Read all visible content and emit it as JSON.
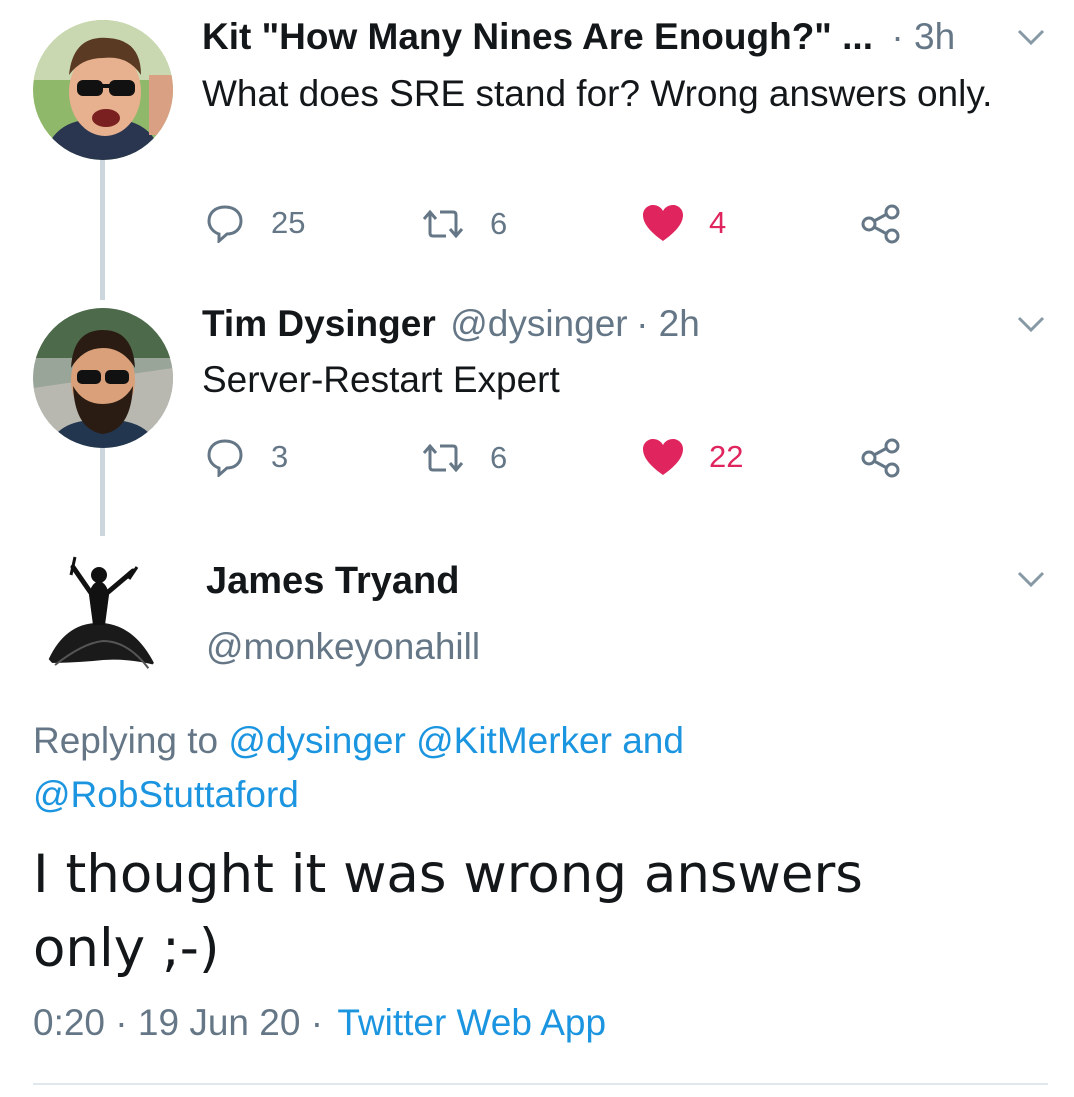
{
  "tweets": [
    {
      "name": "Kit \"How Many Nines Are Enough?\" ...",
      "handle": "",
      "time": "· 3h",
      "text": "What does SRE stand for? Wrong answers only.",
      "reply_count": "25",
      "retweet_count": "6",
      "like_count": "4"
    },
    {
      "name": "Tim Dysinger",
      "handle": "@dysinger",
      "time": "· 2h",
      "text": "Server-Restart Expert",
      "reply_count": "3",
      "retweet_count": "6",
      "like_count": "22"
    }
  ],
  "focused": {
    "name": "James Tryand",
    "handle": "@monkeyonahill",
    "replying_prefix": "Replying to",
    "mention_1": "@dysinger",
    "mention_2": "@KitMerker",
    "and_text": "and",
    "mention_3": "@RobStuttaford",
    "text_line1": "I thought it was wrong answers",
    "text_line2": "only ;-)",
    "timestamp": "0:20 · 19 Jun 20 ·",
    "source": "Twitter Web App"
  },
  "colors": {
    "link": "#1b95e0",
    "like": "#e0245e",
    "secondary": "#657786",
    "thread_line": "#ccd6dd"
  },
  "icons": [
    "reply-icon",
    "retweet-icon",
    "heart-icon",
    "share-icon",
    "chevron-down-icon"
  ]
}
